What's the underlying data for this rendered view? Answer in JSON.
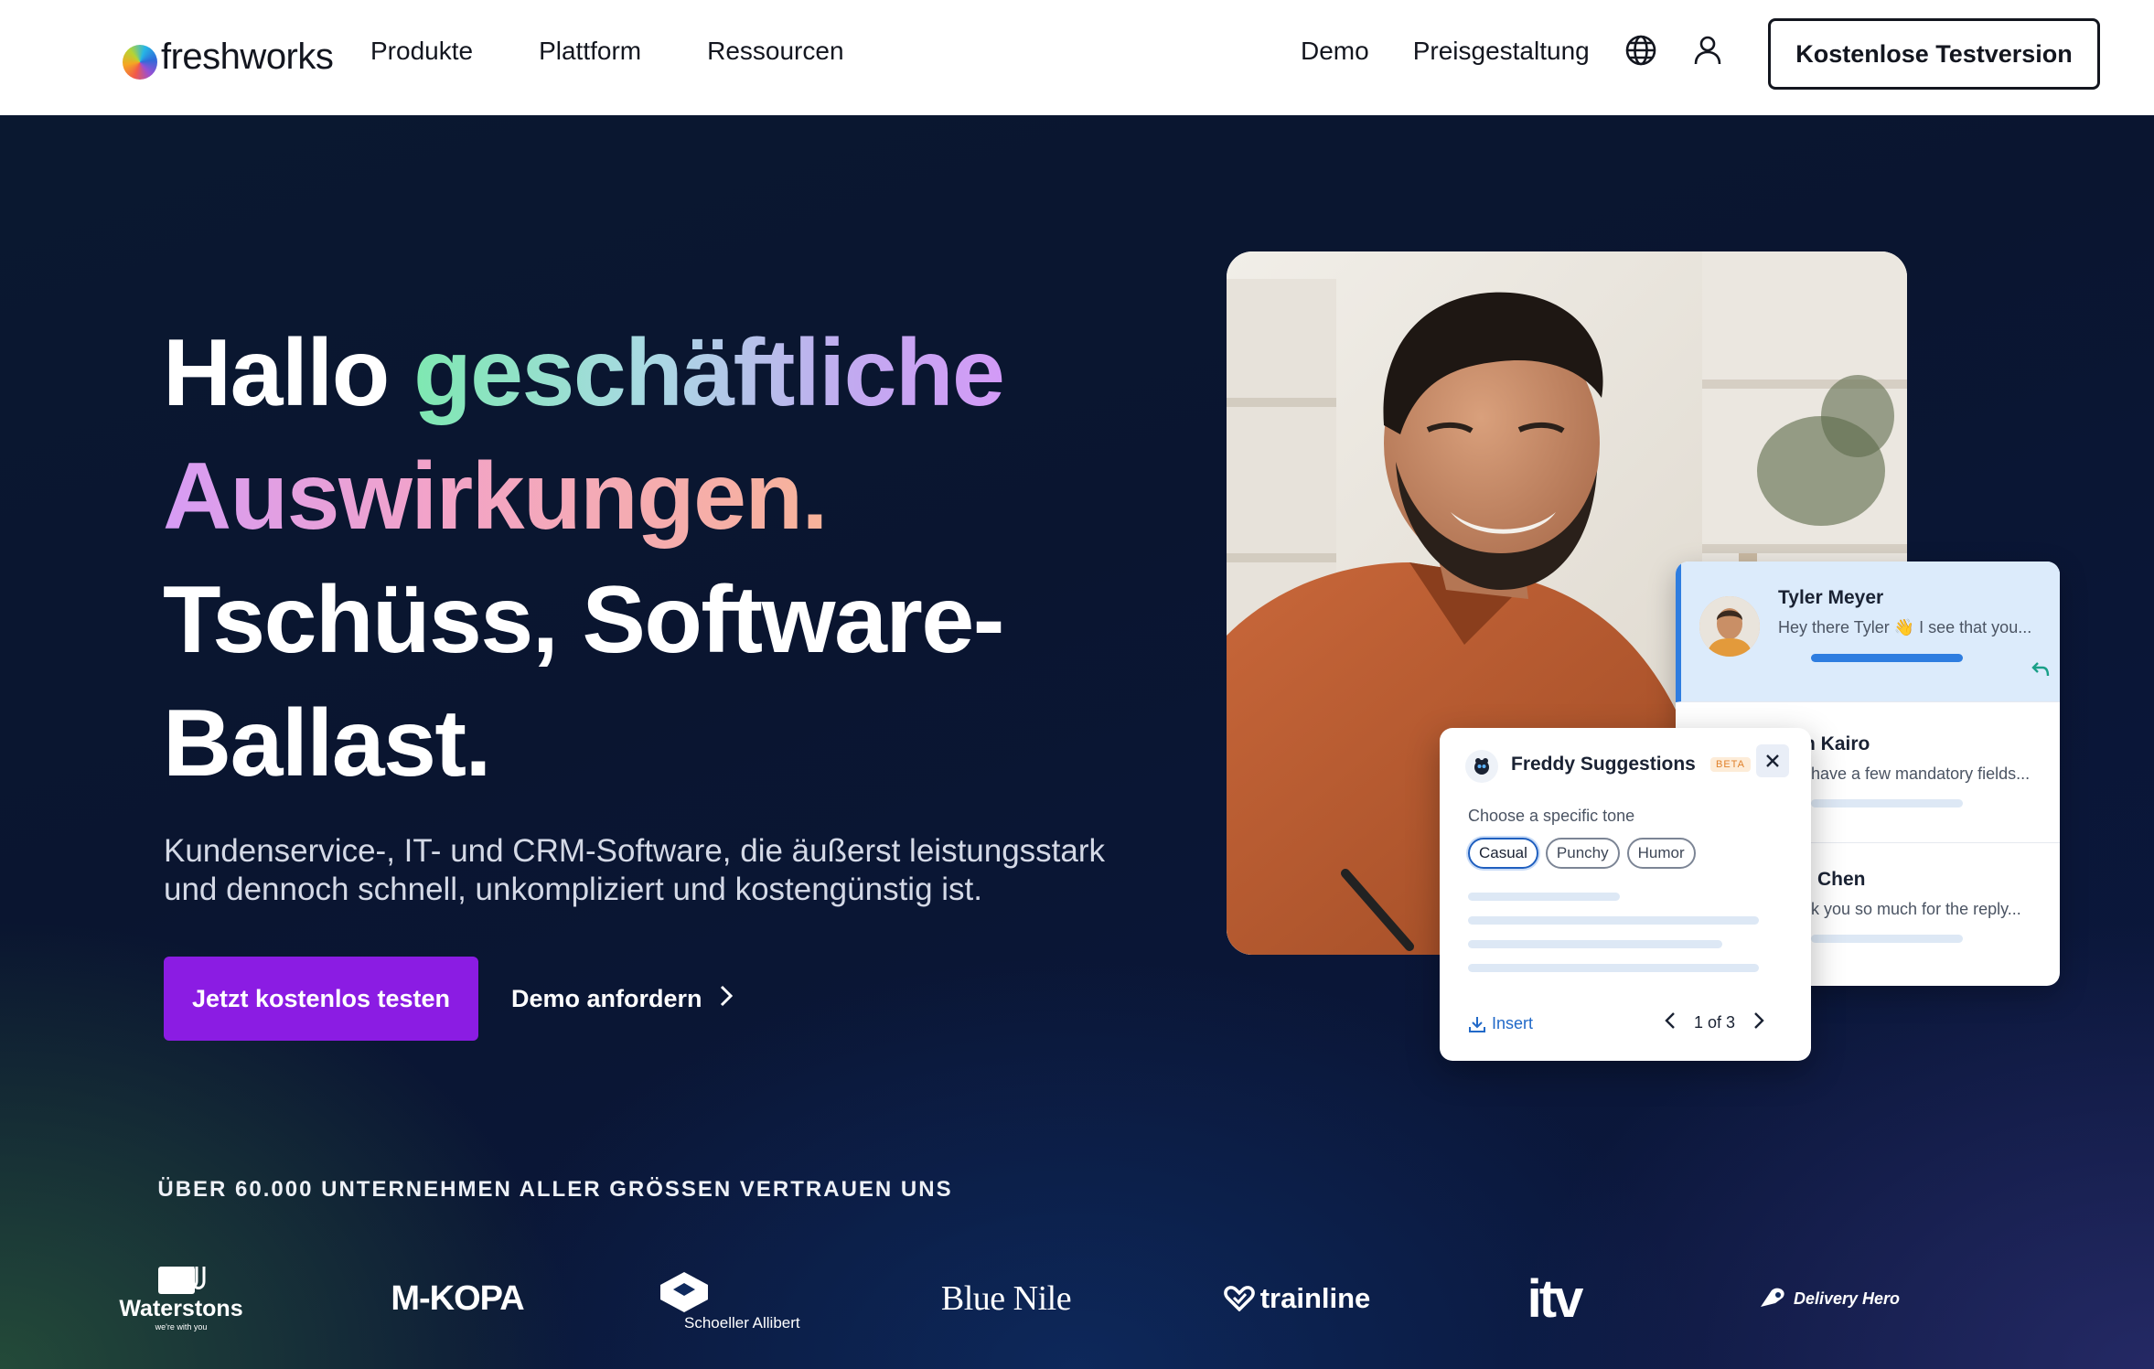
{
  "header": {
    "logo_text": "freshworks",
    "nav_left": [
      "Produkte",
      "Plattform",
      "Ressourcen"
    ],
    "nav_right": [
      "Demo",
      "Preisgestaltung"
    ],
    "cta": "Kostenlose Testversion",
    "icons": [
      "globe-icon",
      "user-icon"
    ]
  },
  "hero": {
    "line1_white": "Hallo ",
    "line1_grad": "geschäftliche",
    "line2_grad": "Auswirkungen.",
    "line3": "Tschüss, Software-",
    "line4": "Ballast.",
    "subtext": "Kundenservice-, IT- und CRM-Software, die äußerst leistungsstark und dennoch schnell, unkompliziert und kostengünstig ist.",
    "primary_button": "Jetzt kostenlos testen",
    "secondary_link": "Demo anfordern"
  },
  "chat_list": {
    "items": [
      {
        "name": "Tyler Meyer",
        "message": "Hey there Tyler 👋 I see that you..."
      },
      {
        "name": "n Kairo",
        "message": "have a few mandatory fields..."
      },
      {
        "name": "Chen",
        "message": "k you so much for the reply..."
      }
    ]
  },
  "freddy": {
    "title": "Freddy Suggestions",
    "badge": "BETA",
    "tone_label": "Choose a specific tone",
    "tones": [
      "Casual",
      "Punchy",
      "Humor"
    ],
    "selected_tone": "Casual",
    "insert_label": "Insert",
    "pager": "1 of 3"
  },
  "trust": {
    "headline": "ÜBER 60.000 UNTERNEHMEN ALLER GRÖSSEN VERTRAUEN UNS",
    "logos": [
      "Waterstons",
      "M-KOPA",
      "Schoeller Allibert",
      "Blue Nile",
      "trainline",
      "itv",
      "Delivery Hero"
    ],
    "waterstons_tagline": "we're with you"
  },
  "colors": {
    "primary": "#8b1ce3",
    "hero_bg": "#0a1530",
    "accent_blue": "#2e7de0"
  }
}
